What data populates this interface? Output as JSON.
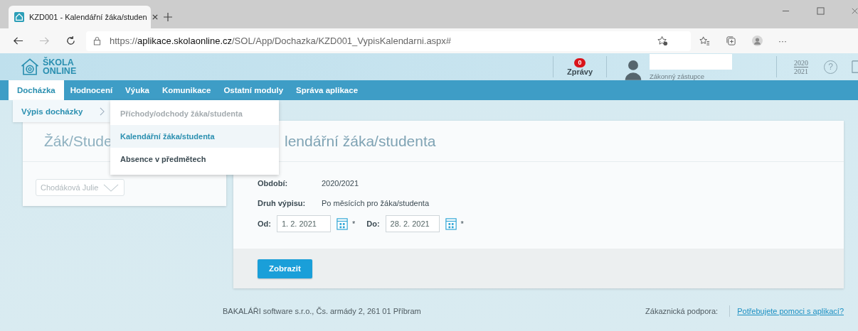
{
  "browser": {
    "tab": {
      "title": "KZD001 - Kalendářní žáka/studen"
    },
    "url": {
      "scheme": "https://",
      "host": "aplikace.skolaonline.cz",
      "path": "/SOL/App/Dochazka/KZD001_VypisKalendarni.aspx#"
    },
    "more": "···"
  },
  "header": {
    "logo": [
      "ŠKOLA",
      "ONLINE"
    ],
    "messages": {
      "count": "0",
      "label": "Zprávy"
    },
    "user": {
      "role": "Zákonný zástupce"
    },
    "school_year": [
      "2020",
      "2021"
    ],
    "help": "?"
  },
  "nav": [
    {
      "label": "Docházka",
      "selected": true
    },
    {
      "label": "Hodnocení",
      "selected": false
    },
    {
      "label": "Výuka",
      "selected": false
    },
    {
      "label": "Komunikace",
      "selected": false
    },
    {
      "label": "Ostatní moduly",
      "selected": false
    },
    {
      "label": "Správa aplikace",
      "selected": false
    }
  ],
  "submenu": {
    "label": "Výpis docházky",
    "items": [
      {
        "label": "Příchody/odchody žáka/studenta",
        "selected": false,
        "disabled": true
      },
      {
        "label": "Kalendářní žáka/studenta",
        "selected": true,
        "disabled": false
      },
      {
        "label": "Absence v předmětech",
        "selected": false,
        "disabled": false
      }
    ]
  },
  "student_card": {
    "title": "Žák/Stude",
    "student": "Chodáková Julie"
  },
  "report_card": {
    "title": "lendářní žáka/studenta",
    "fields": [
      {
        "label": "Období:",
        "value": "2020/2021"
      },
      {
        "label": "Druh výpisu:",
        "value": "Po měsících pro žáka/studenta"
      }
    ],
    "dates": [
      {
        "label": "Od:",
        "value": "1. 2. 2021",
        "required": "*"
      },
      {
        "label": "Do:",
        "value": "28. 2. 2021",
        "required": "*"
      }
    ],
    "button": "Zobrazit"
  },
  "footer": {
    "company": "BAKALÁŘI software s.r.o., Čs. armády 2, 261 01 Příbram",
    "support_label": "Zákaznická podpora:",
    "support_link": "Potřebujete pomoci s aplikací?"
  }
}
